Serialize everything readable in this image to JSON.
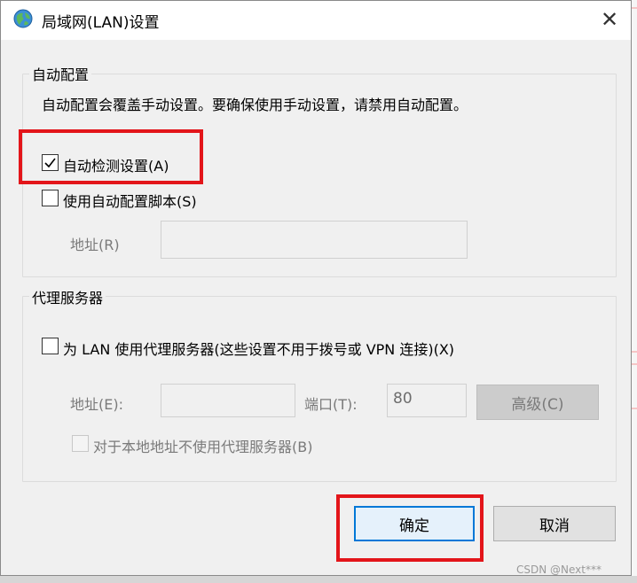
{
  "dialog": {
    "title": "局域网(LAN)设置",
    "close_label": "✕"
  },
  "auto_config": {
    "group_label": "自动配置",
    "description": "自动配置会覆盖手动设置。要确保使用手动设置，请禁用自动配置。",
    "auto_detect_label": "自动检测设置(A)",
    "auto_detect_checked": true,
    "use_script_label": "使用自动配置脚本(S)",
    "use_script_checked": false,
    "address_label": "地址(R)",
    "address_value": ""
  },
  "proxy": {
    "group_label": "代理服务器",
    "use_proxy_label": "为 LAN 使用代理服务器(这些设置不用于拨号或 VPN 连接)(X)",
    "use_proxy_checked": false,
    "address_label": "地址(E):",
    "address_value": "",
    "port_label": "端口(T):",
    "port_value": "80",
    "advanced_label": "高级(C)",
    "bypass_local_label": "对于本地地址不使用代理服务器(B)",
    "bypass_local_checked": false
  },
  "buttons": {
    "ok_label": "确定",
    "cancel_label": "取消"
  },
  "watermark": "CSDN @Next***",
  "colors": {
    "highlight": "#e3151a",
    "ok_border": "#0078d7"
  }
}
